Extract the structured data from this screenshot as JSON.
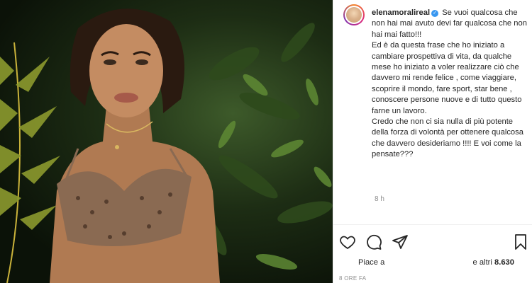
{
  "post": {
    "username": "elenamoralireal",
    "verified_badge": "✓",
    "caption": "Se vuoi qualcosa che non hai mai avuto devi far qualcosa che non hai mai fatto!!!\nEd è da questa frase che ho iniziato a cambiare prospettiva di vita, da qualche mese ho iniziato a voler realizzare ciò che davvero mi rende felice , come viaggiare, scoprire il mondo, fare sport, star bene , conoscere persone nuove e di tutto questo farne un lavoro.\nCredo che non ci sia nulla di più potente della forza di volontà per ottenere qualcosa che davvero desideriamo !!!! E voi come la pensate???",
    "timestamp": "8 h",
    "likes_prefix": "Piace a",
    "likes_suffix": "e altri",
    "likes_count": "8.630",
    "date": "8 ORE FA"
  },
  "icons": {
    "like": "heart-icon",
    "comment": "comment-icon",
    "share": "share-icon",
    "save": "bookmark-icon"
  },
  "colors": {
    "text": "#262626",
    "muted": "#8e8e8e",
    "verified": "#3897f0",
    "divider": "#efefef"
  }
}
